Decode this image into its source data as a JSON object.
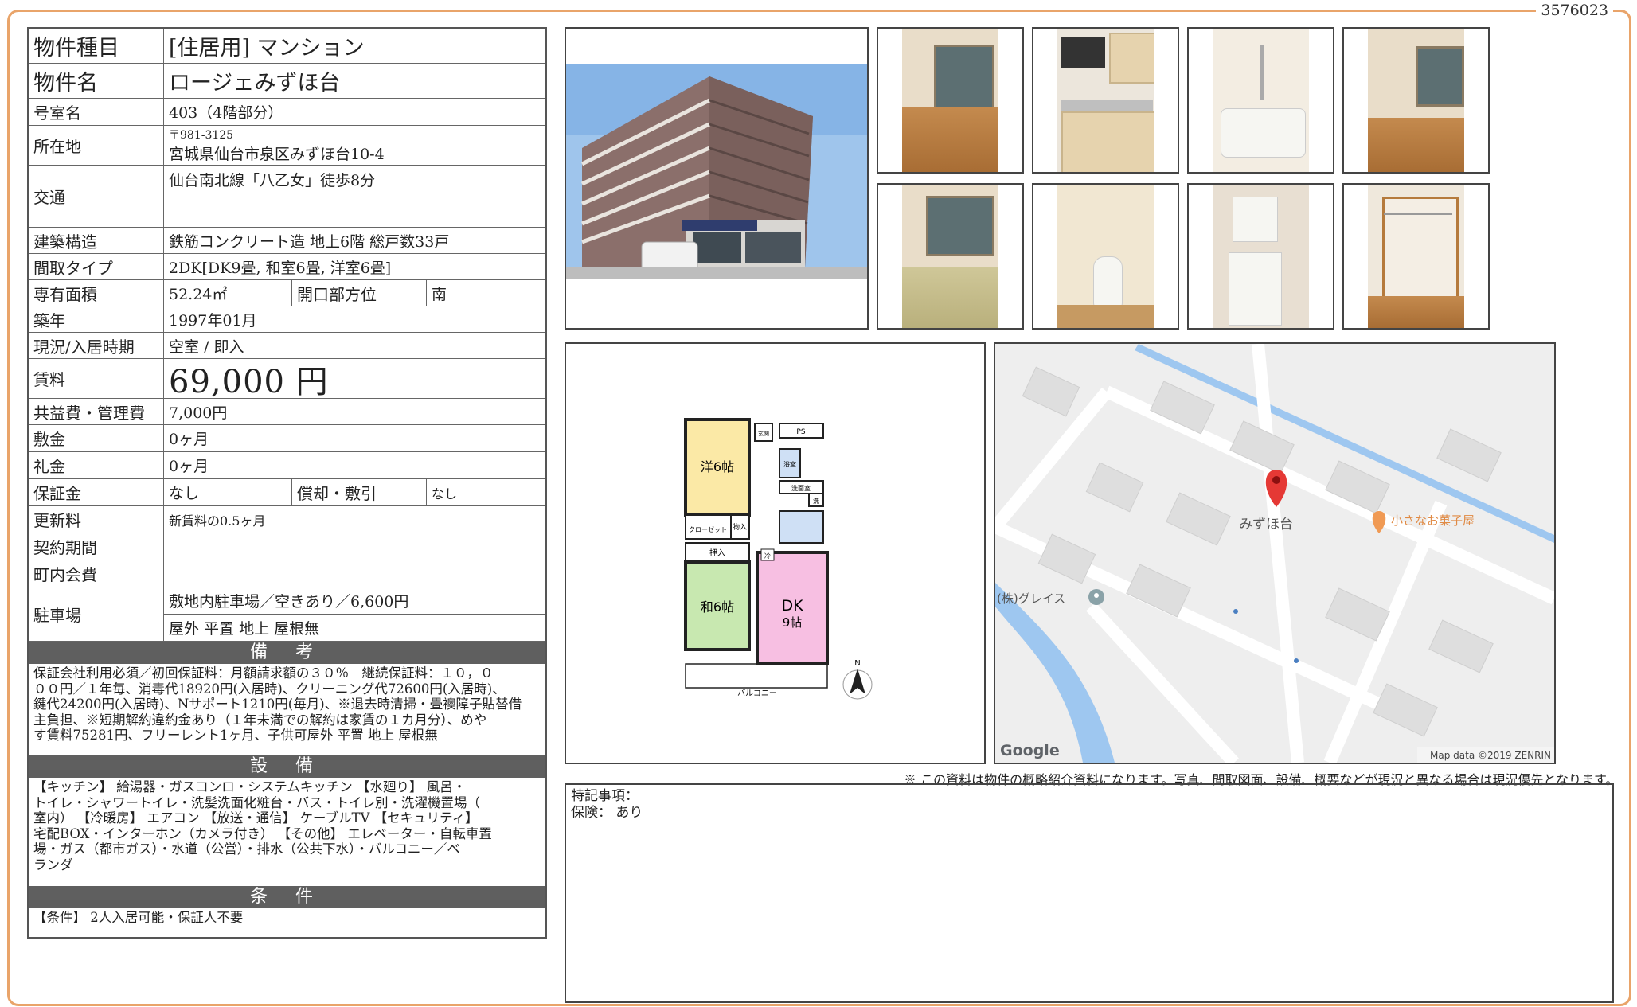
{
  "doc_id": "3576023",
  "info": {
    "property_type_label": "物件種目",
    "property_type_value": "[住居用]  マンション",
    "property_name_label": "物件名",
    "property_name_value": "ロージェみずほ台",
    "room_label": "号室名",
    "room_value": "403（4階部分）",
    "address_label": "所在地",
    "address_postal": "〒981-3125",
    "address_value": "宮城県仙台市泉区みずほ台10-4",
    "transit_label": "交通",
    "transit_value": "仙台南北線「八乙女」徒歩8分",
    "structure_label": "建築構造",
    "structure_value": "鉄筋コンクリート造  地上6階  総戸数33戸",
    "layout_label": "間取タイプ",
    "layout_value": "2DK[DK9畳, 和室6畳, 洋室6畳]",
    "area_label": "専有面積",
    "area_value": "52.24㎡",
    "direction_label": "開口部方位",
    "direction_value": "南",
    "built_label": "築年",
    "built_value": "1997年01月",
    "status_label": "現況/入居時期",
    "status_value": "空室  /  即入",
    "rent_label": "賃料",
    "rent_value": "69,000 円",
    "fee_label": "共益費・管理費",
    "fee_value": "7,000円",
    "deposit_label": "敷金",
    "deposit_value": "0ヶ月",
    "keymoney_label": "礼金",
    "keymoney_value": "0ヶ月",
    "guarantee_label": "保証金",
    "guarantee_value": "なし",
    "amortization_label": "償却・敷引",
    "amortization_value": "なし",
    "renewal_label": "更新料",
    "renewal_value": "新賃料の0.5ヶ月",
    "contract_label": "契約期間",
    "contract_value": "",
    "community_label": "町内会費",
    "community_value": "",
    "parking_label": "駐車場",
    "parking_value_1": "敷地内駐車場／空きあり／6,600円",
    "parking_value_2": "屋外  平置  地上  屋根無"
  },
  "remarks_section": {
    "heading": "備 考",
    "text": "保証会社利用必須／初回保証料：月額請求額の３０％　継続保証料：１０，０\n００円／１年毎、消毒代18920円(入居時)、クリーニング代72600円(入居時)、\n鍵代24200円(入居時)、Nサポート1210円(毎月)、※退去時清掃・畳襖障子貼替借\n主負担、※短期解約違約金あり（１年未満での解約は家賃の１カ月分）、めや\nす賃料75281円、フリーレント1ヶ月、子供可屋外 平置 地上 屋根無"
  },
  "equipment_section": {
    "heading": "設 備",
    "text": "【キッチン】 給湯器・ガスコンロ・システムキッチン 【水廻り】 風呂・\nトイレ・シャワートイレ・洗髪洗面化粧台・バス・トイレ別・洗濯機置場（\n室内） 【冷暖房】 エアコン 【放送・通信】 ケーブルTV 【セキュリティ】\n宅配BOX・インターホン（カメラ付き） 【その他】 エレベーター・自転車置\n場・ガス（都市ガス）・水道（公営）・排水（公共下水）・バルコニー／ベ\nランダ"
  },
  "conditions_section": {
    "heading": "条 件",
    "text": "【条件】 2人入居可能・保証人不要"
  },
  "floorplan": {
    "room_western": "洋6帖",
    "room_japanese": "和6帖",
    "room_dk": "DK\n9帖",
    "genkan": "玄関",
    "ps": "PS",
    "bath": "浴室",
    "laundry": "洗面室",
    "wash": "洗",
    "closet": "クローゼット",
    "storage": "物入",
    "oshiire": "押入",
    "fridge": "冷",
    "balcony": "バルコニー",
    "north": "N"
  },
  "map": {
    "pin_label": "みずほ台",
    "shop_label": "小さなお菓子屋",
    "company_label": "(株)グレイス",
    "google_logo": "Google",
    "attribution": "Map data ©2019 ZENRIN"
  },
  "disclaimer": "※ この資料は物件の概略紹介資料になります。写真、間取図面、設備、概要などが現況と異なる場合は現況優先となります。",
  "special_notes": {
    "line1": "特記事項：",
    "line2": "保険：  あり"
  },
  "colors": {
    "frame": "#e9a46a",
    "section_head": "#5f5f5f",
    "western_room": "#fbe9a6",
    "japanese_room": "#c8e8b0",
    "dk_room": "#f7bfe2",
    "bath": "#cfe0f5",
    "map_pin": "#e53935",
    "shop_pin": "#f09a54"
  }
}
